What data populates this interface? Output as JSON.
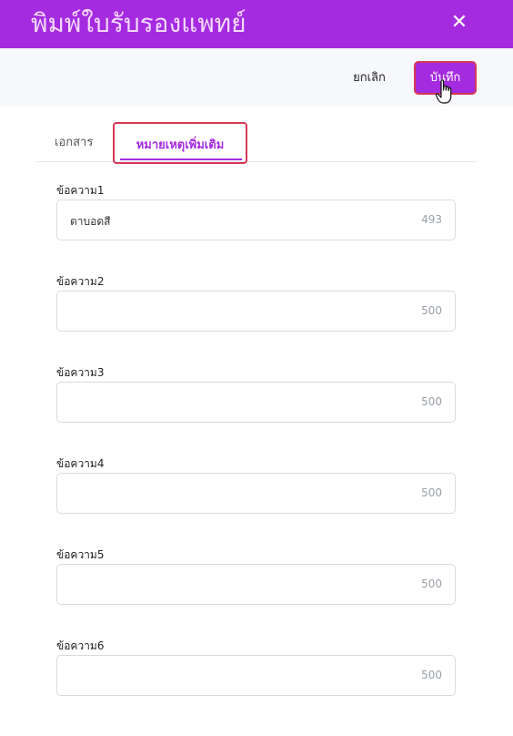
{
  "header": {
    "title": "พิมพ์ใบรับรองแพทย์",
    "close_icon": "close-icon"
  },
  "toolbar": {
    "cancel_label": "ยกเลิก",
    "save_label": "บันทึก"
  },
  "tabs": [
    {
      "label": "เอกสาร",
      "active": false
    },
    {
      "label": "หมายเหตุเพิ่มเติม",
      "active": true
    }
  ],
  "fields": [
    {
      "label": "ข้อความ1",
      "value": "ตาบอดสี",
      "count": "493"
    },
    {
      "label": "ข้อความ2",
      "value": "",
      "count": "500"
    },
    {
      "label": "ข้อความ3",
      "value": "",
      "count": "500"
    },
    {
      "label": "ข้อความ4",
      "value": "",
      "count": "500"
    },
    {
      "label": "ข้อความ5",
      "value": "",
      "count": "500"
    },
    {
      "label": "ข้อความ6",
      "value": "",
      "count": "500"
    }
  ],
  "colors": {
    "accent": "#a52be0",
    "highlight": "#d43a57"
  }
}
